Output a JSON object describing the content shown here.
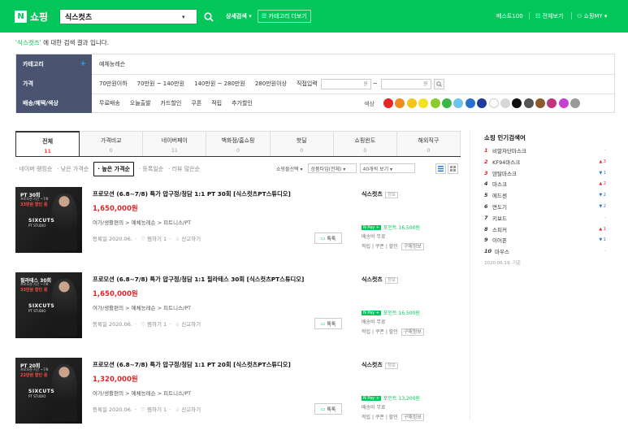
{
  "header": {
    "logo_letter": "N",
    "logo_text": "쇼핑",
    "search_value": "식스컷츠",
    "advanced_search": "상세검색 ▾",
    "category_more": "☰ 카테고리 더보기",
    "best100": "베스트100",
    "all_categories": "☷ 전체보기",
    "my_shopping": "⚇ 쇼핑MY ▾"
  },
  "result_message": {
    "keyword": "'식스컷츠'",
    "suffix": " 에 대한 검색 결과 입니다."
  },
  "filters": {
    "category": {
      "label": "카테고리",
      "value": "예체능레슨"
    },
    "price": {
      "label": "가격",
      "options": [
        "70만원이하",
        "70만원 ~ 140만원",
        "140만원 ~ 280만원",
        "280만원이상"
      ],
      "direct_label": "직접입력",
      "unit": "원"
    },
    "shipping": {
      "label": "배송/혜택/색상",
      "options": [
        "무료배송",
        "오늘출발",
        "카드할인",
        "쿠폰",
        "적립",
        "추가할인"
      ],
      "color_label": "색상"
    },
    "colors": [
      "#e52528",
      "#f28c20",
      "#f5c518",
      "#f2e31f",
      "#8ccc2c",
      "#3cb54a",
      "#6ec4e8",
      "#2b6fce",
      "#1f3b9b",
      "#ffffff",
      "#d7d7d7",
      "#111111",
      "#555555",
      "#8b5a2b",
      "#c0357c",
      "#c93fd0",
      "#9a9a9a"
    ]
  },
  "tabs": [
    {
      "label": "전체",
      "count": "11"
    },
    {
      "label": "가격비교",
      "count": "0"
    },
    {
      "label": "네이버페이",
      "count": "11"
    },
    {
      "label": "백화점/홈쇼핑",
      "count": "0"
    },
    {
      "label": "핫딜",
      "count": "0"
    },
    {
      "label": "쇼핑윈도",
      "count": "0"
    },
    {
      "label": "해외직구",
      "count": "0"
    }
  ],
  "sorts": [
    "· 네이버 랭킹순",
    "· 낮은 가격순",
    "· 높은 가격순",
    "· 등록일순",
    "· 리뷰 많은순"
  ],
  "selects": {
    "mall_type": "쇼핑몰선택 ▾",
    "product_type": "상품타입(전체) ▾",
    "per_page": "40개씩 보기 ▾"
  },
  "products": [
    {
      "thumb_title": "PT 30회",
      "thumb_sub": "프로모션 기간 ~7/8",
      "thumb_disc": "33만원 할인 중",
      "title": "프로모션 (6.8~7/8) 특가 압구정/청담 1:1 PT 30회 [식스컷츠PT스튜디오]",
      "price": "1,650,000원",
      "category": "여가/생활편의 > 예체능레슨 > 피트니스/PT",
      "date": "등록일 2020.06.",
      "wish": "♡ 찜하기 1",
      "report": "♤ 신고하기",
      "talk": "톡톡",
      "mall": "식스컷츠",
      "mall_tag": "정보",
      "npay": "포인트 16,500원",
      "ship": "배송비 무료",
      "opts": [
        "적립",
        "쿠폰",
        "할인",
        "구매정보"
      ]
    },
    {
      "thumb_title": "필라테스 30회",
      "thumb_sub": "프로모션 기간 ~7/8",
      "thumb_disc": "33만원 할인 중",
      "title": "프로모션 (6.8~7/8) 특가 압구정/청담 1:1 필라테스 30회 [식스컷츠PT스튜디오]",
      "price": "1,650,000원",
      "category": "여가/생활편의 > 예체능레슨 > 피트니스/PT",
      "date": "등록일 2020.06.",
      "wish": "♡ 찜하기 1",
      "report": "♤ 신고하기",
      "talk": "톡톡",
      "mall": "식스컷츠",
      "mall_tag": "정보",
      "npay": "포인트 16,500원",
      "ship": "배송비 무료",
      "opts": [
        "적립",
        "쿠폰",
        "할인",
        "구매정보"
      ]
    },
    {
      "thumb_title": "PT 20회",
      "thumb_sub": "프로모션 기간 ~7/8",
      "thumb_disc": "22만원 할인 중",
      "title": "프로모션 (6.8~7/8) 특가 압구정/청담 1:1 PT 20회 [식스컷츠PT스튜디오]",
      "price": "1,320,000원",
      "category": "여가/생활편의 > 예체능레슨 > 피트니스/PT",
      "date": "등록일 2020.06.",
      "wish": "♡ 찜하기 1",
      "report": "♤ 신고하기",
      "talk": "톡톡",
      "mall": "식스컷츠",
      "mall_tag": "정보",
      "npay": "포인트 13,200원",
      "ship": "배송비 무료",
      "opts": [
        "적립",
        "쿠폰",
        "할인",
        "구매정보"
      ]
    }
  ],
  "thumb_brand": "SIXCUTS",
  "thumb_brand2": "PT STUDIO",
  "sidebar": {
    "title": "쇼핑 인기검색어",
    "items": [
      {
        "rank": "1",
        "keyword": "비말차단마스크",
        "change": "-",
        "dir": "same"
      },
      {
        "rank": "2",
        "keyword": "KF94마스크",
        "change": "▲ 3",
        "dir": "up"
      },
      {
        "rank": "3",
        "keyword": "덴탈마스크",
        "change": "▼ 1",
        "dir": "down"
      },
      {
        "rank": "4",
        "keyword": "마스크",
        "change": "▲ 2",
        "dir": "up"
      },
      {
        "rank": "5",
        "keyword": "에드센",
        "change": "▼ 2",
        "dir": "down"
      },
      {
        "rank": "6",
        "keyword": "면도기",
        "change": "▼ 2",
        "dir": "down"
      },
      {
        "rank": "7",
        "keyword": "키보드",
        "change": "-",
        "dir": "same"
      },
      {
        "rank": "8",
        "keyword": "스피커",
        "change": "▲ 1",
        "dir": "up"
      },
      {
        "rank": "9",
        "keyword": "이어폰",
        "change": "▼ 1",
        "dir": "down"
      },
      {
        "rank": "10",
        "keyword": "마우스",
        "change": "-",
        "dir": "same"
      }
    ],
    "date": "2020.06.19. 기준"
  }
}
